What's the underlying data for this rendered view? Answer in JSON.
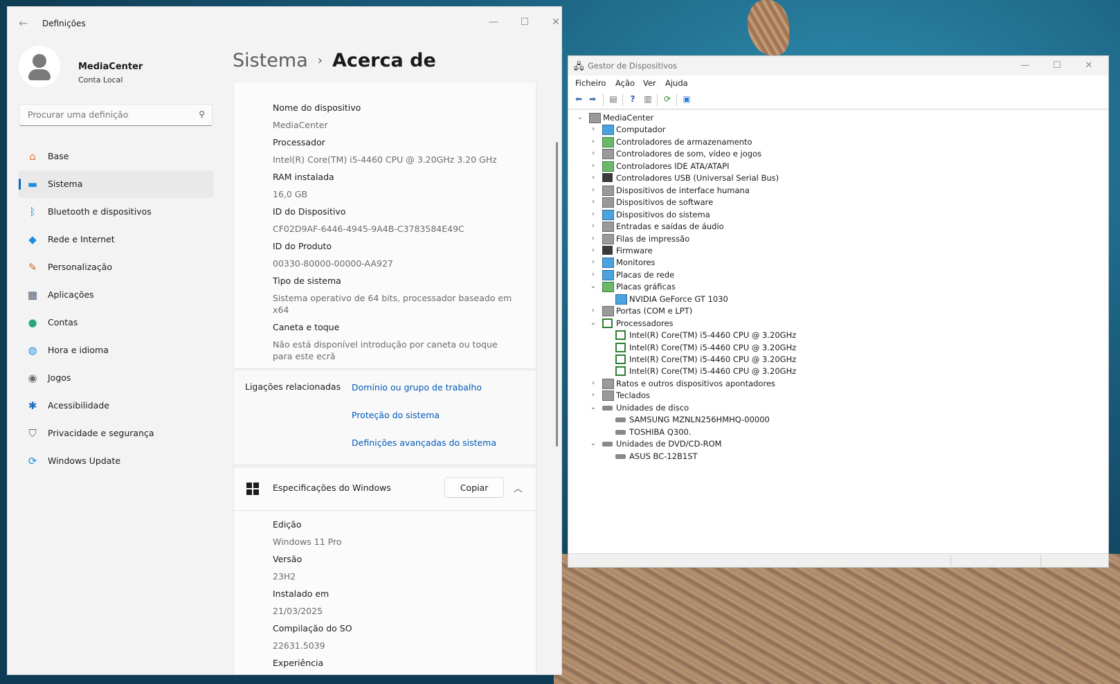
{
  "settings": {
    "app_title": "Definições",
    "back_icon": "arrow-left-icon",
    "user": {
      "name": "MediaCenter",
      "account": "Conta Local"
    },
    "search_placeholder": "Procurar uma definição",
    "nav": [
      {
        "label": "Base",
        "icon": "home-icon",
        "color": "#e8742f"
      },
      {
        "label": "Sistema",
        "icon": "monitor-icon",
        "color": "#1a8ee0",
        "active": true
      },
      {
        "label": "Bluetooth e dispositivos",
        "icon": "bluetooth-icon",
        "color": "#1a8ee0"
      },
      {
        "label": "Rede e Internet",
        "icon": "wifi-icon",
        "color": "#1a8ee0"
      },
      {
        "label": "Personalização",
        "icon": "brush-icon",
        "color": "#d06a2a"
      },
      {
        "label": "Aplicações",
        "icon": "apps-icon",
        "color": "#4a5a6a"
      },
      {
        "label": "Contas",
        "icon": "person-icon",
        "color": "#2aa87a"
      },
      {
        "label": "Hora e idioma",
        "icon": "globe-clock-icon",
        "color": "#1a8ee0"
      },
      {
        "label": "Jogos",
        "icon": "gamepad-icon",
        "color": "#6a6a6a"
      },
      {
        "label": "Acessibilidade",
        "icon": "accessibility-icon",
        "color": "#1a6fc0"
      },
      {
        "label": "Privacidade e segurança",
        "icon": "shield-icon",
        "color": "#6a6a6a"
      },
      {
        "label": "Windows Update",
        "icon": "update-icon",
        "color": "#1a8ee0"
      }
    ],
    "breadcrumb": {
      "parent": "Sistema",
      "current": "Acerca de"
    },
    "device_specs": [
      {
        "label": "Nome do dispositivo",
        "value": "MediaCenter"
      },
      {
        "label": "Processador",
        "value": "Intel(R) Core(TM) i5-4460  CPU @ 3.20GHz   3.20 GHz"
      },
      {
        "label": "RAM instalada",
        "value": "16,0 GB"
      },
      {
        "label": "ID do Dispositivo",
        "value": "CF02D9AF-6446-4945-9A4B-C3783584E49C"
      },
      {
        "label": "ID do Produto",
        "value": "00330-80000-00000-AA927"
      },
      {
        "label": "Tipo de sistema",
        "value": "Sistema operativo de 64 bits, processador baseado em x64"
      },
      {
        "label": "Caneta e toque",
        "value": "Não está disponível introdução por caneta ou toque para este ecrã"
      }
    ],
    "related_links": {
      "title": "Ligações relacionadas",
      "links": [
        "Domínio ou grupo de trabalho",
        "Proteção do sistema",
        "Definições avançadas do sistema"
      ]
    },
    "windows_specs": {
      "title": "Especificações do Windows",
      "copy_label": "Copiar",
      "items": [
        {
          "label": "Edição",
          "value": "Windows 11 Pro"
        },
        {
          "label": "Versão",
          "value": "23H2"
        },
        {
          "label": "Instalado em",
          "value": "21/03/2025"
        },
        {
          "label": "Compilação do SO",
          "value": "22631.5039"
        },
        {
          "label": "Experiência",
          "value": ""
        }
      ]
    }
  },
  "devmgr": {
    "title": "Gestor de Dispositivos",
    "menu": [
      "Ficheiro",
      "Ação",
      "Ver",
      "Ajuda"
    ],
    "tree": [
      {
        "level": 0,
        "state": "open",
        "label": "MediaCenter",
        "icon": "ico-gray"
      },
      {
        "level": 1,
        "state": "closed",
        "label": "Computador",
        "icon": "ico-pc"
      },
      {
        "level": 1,
        "state": "closed",
        "label": "Controladores de armazenamento",
        "icon": "ico-green"
      },
      {
        "level": 1,
        "state": "closed",
        "label": "Controladores de som, vídeo e jogos",
        "icon": "ico-gray"
      },
      {
        "level": 1,
        "state": "closed",
        "label": "Controladores IDE ATA/ATAPI",
        "icon": "ico-green"
      },
      {
        "level": 1,
        "state": "closed",
        "label": "Controladores USB (Universal Serial Bus)",
        "icon": "ico-dark"
      },
      {
        "level": 1,
        "state": "closed",
        "label": "Dispositivos de interface humana",
        "icon": "ico-gray"
      },
      {
        "level": 1,
        "state": "closed",
        "label": "Dispositivos de software",
        "icon": "ico-gray"
      },
      {
        "level": 1,
        "state": "closed",
        "label": "Dispositivos do sistema",
        "icon": "ico-pc"
      },
      {
        "level": 1,
        "state": "closed",
        "label": "Entradas e saídas de áudio",
        "icon": "ico-gray"
      },
      {
        "level": 1,
        "state": "closed",
        "label": "Filas de impressão",
        "icon": "ico-gray"
      },
      {
        "level": 1,
        "state": "closed",
        "label": "Firmware",
        "icon": "ico-dark"
      },
      {
        "level": 1,
        "state": "closed",
        "label": "Monitores",
        "icon": "ico-pc"
      },
      {
        "level": 1,
        "state": "closed",
        "label": "Placas de rede",
        "icon": "ico-pc"
      },
      {
        "level": 1,
        "state": "open",
        "label": "Placas gráficas",
        "icon": "ico-green"
      },
      {
        "level": 2,
        "state": "leaf",
        "label": "NVIDIA GeForce GT 1030",
        "icon": "ico-pc"
      },
      {
        "level": 1,
        "state": "closed",
        "label": "Portas (COM e LPT)",
        "icon": "ico-gray"
      },
      {
        "level": 1,
        "state": "open",
        "label": "Processadores",
        "icon": "ico-cpu"
      },
      {
        "level": 2,
        "state": "leaf",
        "label": "Intel(R) Core(TM) i5-4460  CPU @ 3.20GHz",
        "icon": "ico-cpu"
      },
      {
        "level": 2,
        "state": "leaf",
        "label": "Intel(R) Core(TM) i5-4460  CPU @ 3.20GHz",
        "icon": "ico-cpu"
      },
      {
        "level": 2,
        "state": "leaf",
        "label": "Intel(R) Core(TM) i5-4460  CPU @ 3.20GHz",
        "icon": "ico-cpu"
      },
      {
        "level": 2,
        "state": "leaf",
        "label": "Intel(R) Core(TM) i5-4460  CPU @ 3.20GHz",
        "icon": "ico-cpu"
      },
      {
        "level": 1,
        "state": "closed",
        "label": "Ratos e outros dispositivos apontadores",
        "icon": "ico-gray"
      },
      {
        "level": 1,
        "state": "closed",
        "label": "Teclados",
        "icon": "ico-gray"
      },
      {
        "level": 1,
        "state": "open",
        "label": "Unidades de disco",
        "icon": "ico-disk"
      },
      {
        "level": 2,
        "state": "leaf",
        "label": "SAMSUNG MZNLN256HMHQ-00000",
        "icon": "ico-disk"
      },
      {
        "level": 2,
        "state": "leaf",
        "label": "TOSHIBA Q300.",
        "icon": "ico-disk"
      },
      {
        "level": 1,
        "state": "open",
        "label": "Unidades de DVD/CD-ROM",
        "icon": "ico-disk"
      },
      {
        "level": 2,
        "state": "leaf",
        "label": "ASUS BC-12B1ST",
        "icon": "ico-disk"
      }
    ]
  }
}
